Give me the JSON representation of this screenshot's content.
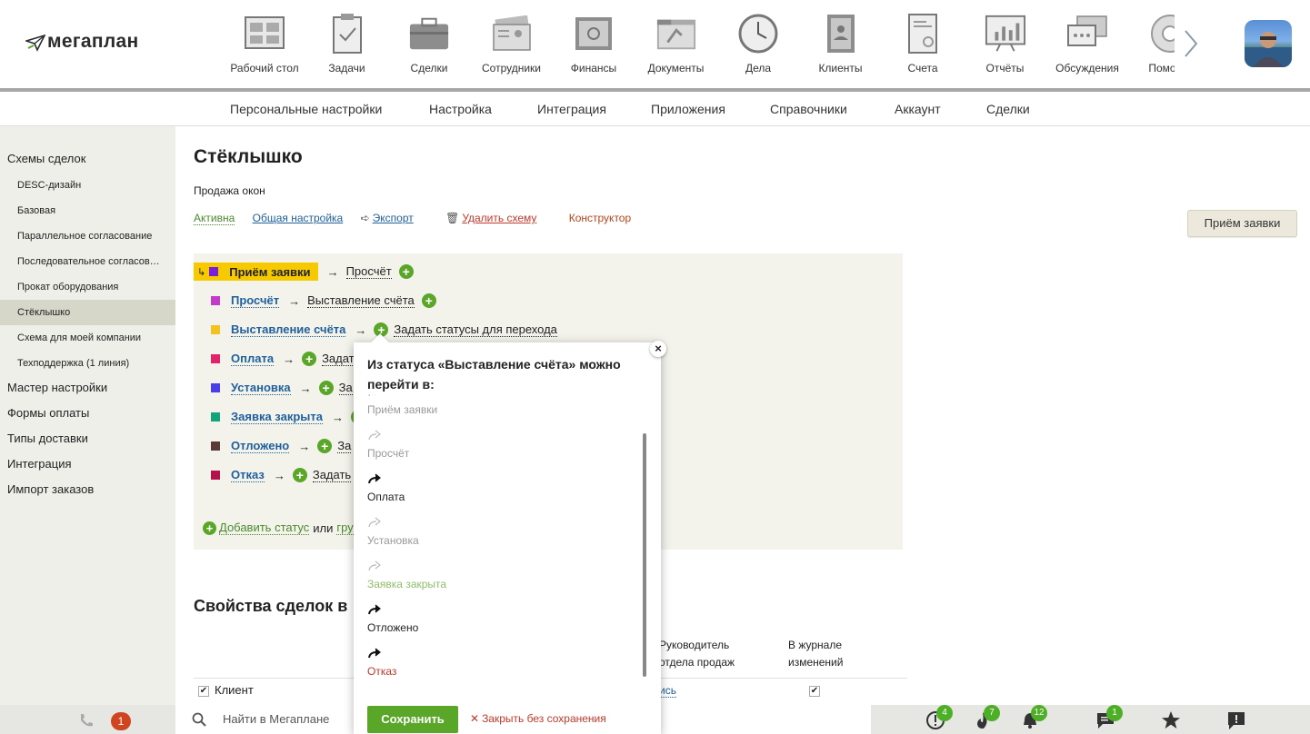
{
  "app": {
    "logo_text": "мегаплан"
  },
  "apps": [
    {
      "label": "Рабочий стол",
      "icon": "desktop-icon"
    },
    {
      "label": "Задачи",
      "icon": "tasks-icon"
    },
    {
      "label": "Сделки",
      "icon": "deals-icon"
    },
    {
      "label": "Сотрудники",
      "icon": "employees-icon"
    },
    {
      "label": "Финансы",
      "icon": "finance-icon"
    },
    {
      "label": "Документы",
      "icon": "documents-icon"
    },
    {
      "label": "Дела",
      "icon": "clock-icon"
    },
    {
      "label": "Клиенты",
      "icon": "clients-icon"
    },
    {
      "label": "Счета",
      "icon": "invoices-icon"
    },
    {
      "label": "Отчёты",
      "icon": "reports-icon"
    },
    {
      "label": "Обсуждения",
      "icon": "discussions-icon"
    },
    {
      "label": "Помощь",
      "icon": "help-icon"
    }
  ],
  "subnav": [
    "Персональные настройки",
    "Настройка",
    "Интеграция",
    "Приложения",
    "Справочники",
    "Аккаунт",
    "Сделки"
  ],
  "sidebar": {
    "items": [
      {
        "label": "Схемы сделок",
        "level": "top"
      },
      {
        "label": "DESC-дизайн",
        "level": "sub"
      },
      {
        "label": "Базовая",
        "level": "sub"
      },
      {
        "label": "Параллельное согласование",
        "level": "sub"
      },
      {
        "label": "Последовательное согласование",
        "level": "sub"
      },
      {
        "label": "Прокат оборудования",
        "level": "sub"
      },
      {
        "label": "Стёклышко",
        "level": "sub",
        "active": true
      },
      {
        "label": "Схема для моей компании",
        "level": "sub"
      },
      {
        "label": "Техподдержка (1 линия)",
        "level": "sub"
      },
      {
        "label": "Мастер настройки",
        "level": "top"
      },
      {
        "label": "Формы оплаты",
        "level": "top"
      },
      {
        "label": "Типы доставки",
        "level": "top"
      },
      {
        "label": "Интеграция",
        "level": "top"
      },
      {
        "label": "Импорт заказов",
        "level": "top"
      }
    ]
  },
  "main": {
    "title": "Стёклышко",
    "subtitle": "Продажа окон",
    "actions": {
      "active": "Активна",
      "general": "Общая настройка",
      "export": "Экспорт",
      "delete": "Удалить схему",
      "constructor": "Конструктор"
    },
    "status_button": "Приём заявки",
    "statuses": [
      {
        "name": "Приём заявки",
        "color": "#7b1fd6",
        "target": "Просчёт",
        "highlight": true
      },
      {
        "name": "Просчёт",
        "color": "#c23bc9",
        "target": "Выставление счёта"
      },
      {
        "name": "Выставление счёта",
        "color": "#f3c21f",
        "target": "Задать статусы для перехода"
      },
      {
        "name": "Оплата",
        "color": "#e0246b",
        "target": "Задат"
      },
      {
        "name": "Установка",
        "color": "#4a3fe6",
        "target": "За"
      },
      {
        "name": "Заявка закрыта",
        "color": "#14a37a",
        "target": ""
      },
      {
        "name": "Отложено",
        "color": "#5a3a36",
        "target": "За"
      },
      {
        "name": "Отказ",
        "color": "#b3134a",
        "target": "Задать"
      }
    ],
    "add_status": "Добавить статус",
    "or_text": "или",
    "group_link": "гру",
    "props_title": "Свойства сделок в",
    "col_manager": "Руководитель отдела продаж",
    "col_journal": "В журнале изменений",
    "row_client": "Клиент",
    "row_partial": "ись"
  },
  "popup": {
    "title": "Из статуса «Выставление счёта» можно перейти в:",
    "items": [
      {
        "label": "Приём заявки",
        "state": "disabled"
      },
      {
        "label": "Просчёт",
        "state": "disabled"
      },
      {
        "label": "Оплата",
        "state": "enabled"
      },
      {
        "label": "Установка",
        "state": "disabled"
      },
      {
        "label": "Заявка закрыта",
        "state": "disabled-green"
      },
      {
        "label": "Отложено",
        "state": "enabled"
      },
      {
        "label": "Отказ",
        "state": "enabled-red"
      }
    ],
    "save": "Сохранить",
    "close_nosave": "Закрыть без сохранения",
    "close_glyph": "×"
  },
  "bottombar": {
    "calls_badge": "1",
    "search_placeholder": "Найти в Мегаплане",
    "badges": {
      "alerts": "4",
      "hot": "7",
      "notifications": "12",
      "messages": "1"
    }
  }
}
